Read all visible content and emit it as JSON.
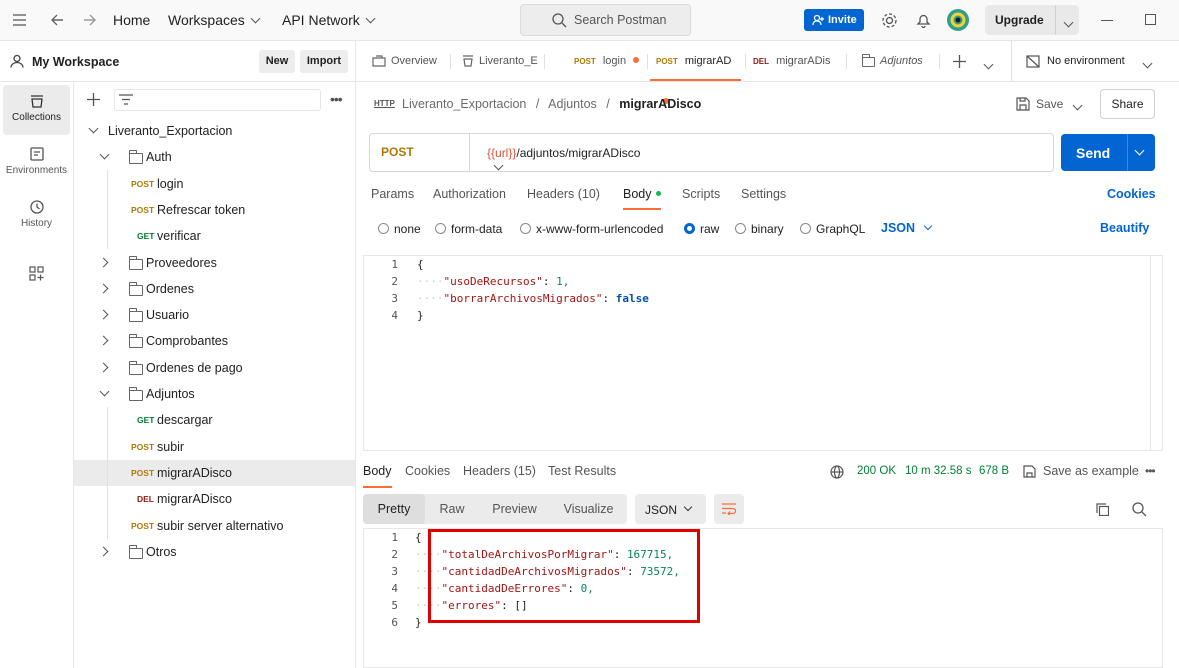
{
  "topbar": {
    "home": "Home",
    "workspaces": "Workspaces",
    "api_network": "API Network",
    "search_placeholder": "Search Postman",
    "invite": "Invite",
    "upgrade": "Upgrade"
  },
  "workspace": {
    "name": "My Workspace",
    "new_label": "New",
    "import_label": "Import"
  },
  "leftnav": [
    {
      "label": "Collections",
      "icon": "collections-icon"
    },
    {
      "label": "Environments",
      "icon": "environments-icon"
    },
    {
      "label": "History",
      "icon": "history-icon"
    }
  ],
  "tree": [
    {
      "label": "Liveranto_Exportacion",
      "type": "collection",
      "depth": 0,
      "expanded": true
    },
    {
      "label": "Auth",
      "type": "folder",
      "depth": 1,
      "expanded": true
    },
    {
      "label": "login",
      "type": "request",
      "method": "POST",
      "depth": 2
    },
    {
      "label": "Refrescar token",
      "type": "request",
      "method": "POST",
      "depth": 2
    },
    {
      "label": "verificar",
      "type": "request",
      "method": "GET",
      "depth": 2
    },
    {
      "label": "Proveedores",
      "type": "folder",
      "depth": 1,
      "expanded": false
    },
    {
      "label": "Ordenes",
      "type": "folder",
      "depth": 1,
      "expanded": false
    },
    {
      "label": "Usuario",
      "type": "folder",
      "depth": 1,
      "expanded": false
    },
    {
      "label": "Comprobantes",
      "type": "folder",
      "depth": 1,
      "expanded": false
    },
    {
      "label": "Ordenes de pago",
      "type": "folder",
      "depth": 1,
      "expanded": false
    },
    {
      "label": "Adjuntos",
      "type": "folder",
      "depth": 1,
      "expanded": true
    },
    {
      "label": "descargar",
      "type": "request",
      "method": "GET",
      "depth": 2
    },
    {
      "label": "subir",
      "type": "request",
      "method": "POST",
      "depth": 2
    },
    {
      "label": "migrarADisco",
      "type": "request",
      "method": "POST",
      "depth": 2,
      "selected": true
    },
    {
      "label": "migrarADisco",
      "type": "request",
      "method": "DEL",
      "depth": 2
    },
    {
      "label": "subir server alternativo",
      "type": "request",
      "method": "POST",
      "depth": 2
    },
    {
      "label": "Otros",
      "type": "folder",
      "depth": 1,
      "expanded": false
    }
  ],
  "tabs": {
    "overview": "Overview",
    "collection": "Liveranto_E",
    "login_method": "POST",
    "login": "login",
    "migrar_method": "POST",
    "migrar": "migrarAD",
    "del_method": "DEL",
    "del": "migrarADis",
    "adjuntos": "Adjuntos",
    "environment": "No environment"
  },
  "request": {
    "breadcrumb_collection": "Liveranto_Exportacion",
    "breadcrumb_folder": "Adjuntos",
    "breadcrumb_sep": "/",
    "name": "migrarADisco",
    "save": "Save",
    "share": "Share",
    "method": "POST",
    "url_var": "{{url}}",
    "url_path": "/adjuntos/migrarADisco",
    "send": "Send",
    "tabs": [
      "Params",
      "Authorization",
      "Headers (10)",
      "Body",
      "Scripts",
      "Settings"
    ],
    "cookies": "Cookies",
    "body_types": [
      "none",
      "form-data",
      "x-www-form-urlencoded",
      "raw",
      "binary",
      "GraphQL"
    ],
    "body_format": "JSON",
    "beautify": "Beautify",
    "body_lines": [
      {
        "n": "1",
        "text": "{"
      },
      {
        "n": "2",
        "key": "\"usoDeRecursos\"",
        "val": "1,",
        "kind": "num"
      },
      {
        "n": "3",
        "key": "\"borrarArchivosMigrados\"",
        "val": "false",
        "kind": "kw"
      },
      {
        "n": "4",
        "text": "}"
      }
    ]
  },
  "response": {
    "tabs": [
      "Body",
      "Cookies",
      "Headers (15)",
      "Test Results"
    ],
    "status": "200 OK",
    "time": "10 m 32.58 s",
    "size": "678 B",
    "save_example": "Save as example",
    "views": [
      "Pretty",
      "Raw",
      "Preview",
      "Visualize"
    ],
    "format": "JSON",
    "lines": [
      {
        "n": "1",
        "text": "{"
      },
      {
        "n": "2",
        "key": "\"totalDeArchivosPorMigrar\"",
        "val": "167715,",
        "kind": "num"
      },
      {
        "n": "3",
        "key": "\"cantidadDeArchivosMigrados\"",
        "val": "73572,",
        "kind": "num"
      },
      {
        "n": "4",
        "key": "\"cantidadDeErrores\"",
        "val": "0,",
        "kind": "num"
      },
      {
        "n": "5",
        "key": "\"errores\"",
        "val": "[]",
        "kind": "plain"
      },
      {
        "n": "6",
        "text": "}"
      }
    ]
  },
  "colors": {
    "accent": "#ff6c37",
    "primary": "#0265d2",
    "highlight_box": "#e00000",
    "status_ok": "#007f31"
  }
}
